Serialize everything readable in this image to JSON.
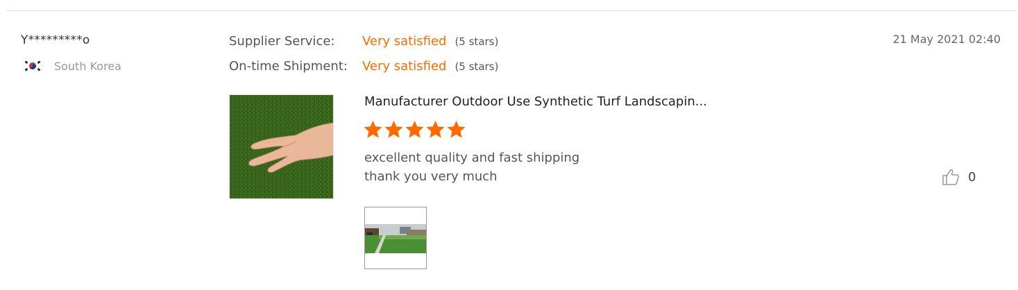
{
  "reviewer": {
    "name": "Y*********o",
    "country": "South Korea",
    "flag_icon": "south-korea-flag-icon"
  },
  "date": "21 May 2021 02:40",
  "ratings": [
    {
      "label": "Supplier Service:",
      "value": "Very satisfied",
      "stars_text": "(5 stars)"
    },
    {
      "label": "On-time Shipment:",
      "value": "Very satisfied",
      "stars_text": "(5 stars)"
    }
  ],
  "product": {
    "title": "Manufacturer Outdoor Use Synthetic Turf Landscapin...",
    "image_icon": "artificial-grass-with-hand-thumbnail",
    "rating": 5,
    "max_rating": 5
  },
  "review": {
    "lines": [
      "excellent quality and fast shipping",
      "thank you very much"
    ]
  },
  "likes": {
    "icon": "thumbs-up-icon",
    "count": "0"
  },
  "attachment": {
    "icon": "installed-lawn-photo-thumbnail"
  },
  "colors": {
    "accent": "#ff6a00",
    "muted_text": "#999999",
    "divider": "#dddddd"
  }
}
